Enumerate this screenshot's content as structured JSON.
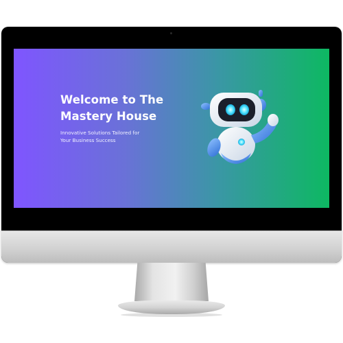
{
  "hero": {
    "title_line1": "Welcome to The",
    "title_line2": "Mastery House",
    "subtitle_line1": "Innovative Solutions Tailored for",
    "subtitle_line2": "Your Business Success"
  },
  "illustration": {
    "name": "robot-mascot",
    "icon": "robot-icon"
  },
  "colors": {
    "gradient_start": "#7f55ff",
    "gradient_end": "#0db862",
    "monitor_bezel": "#000000",
    "title_text": "#ffffff"
  }
}
